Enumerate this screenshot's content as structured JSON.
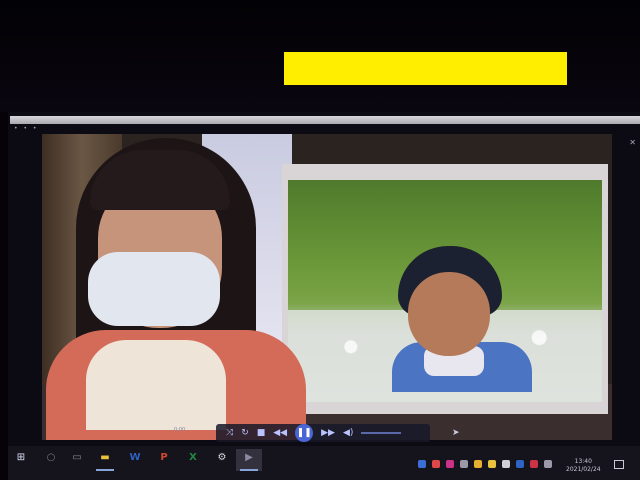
{
  "window": {
    "title_dots": "• • •",
    "close_glyph": "✕"
  },
  "player": {
    "time_elapsed": "0:00",
    "controls": {
      "shuffle_icon": "shuffle-icon",
      "repeat_icon": "repeat-icon",
      "stop_glyph": "■",
      "prev_glyph": "◀◀",
      "pause_glyph": "❚❚",
      "next_glyph": "▶▶",
      "volume_glyph": "🔈"
    },
    "censor_color": "#ffee00"
  },
  "taskbar": {
    "start_glyph": "⊞",
    "search_glyph": "○",
    "taskview_glyph": "▭",
    "apps": [
      {
        "name": "file-explorer",
        "glyph": "▬",
        "color": "#e8c23a"
      },
      {
        "name": "word",
        "glyph": "W",
        "color": "#2e63c4"
      },
      {
        "name": "powerpoint",
        "glyph": "P",
        "color": "#d04a2c"
      },
      {
        "name": "excel",
        "glyph": "X",
        "color": "#1f8a44"
      },
      {
        "name": "settings",
        "glyph": "⚙",
        "color": "#d8d8e0"
      },
      {
        "name": "media-player",
        "glyph": "▶",
        "color": "#8a8aa0"
      }
    ],
    "clock_time": "13:40",
    "clock_date": "2021/02/24",
    "tray_colors": [
      "#3b6fd8",
      "#e04848",
      "#cc3388",
      "#9a9aaa",
      "#e8b030",
      "#e8c23a",
      "#cfcfd8",
      "#2e63c4",
      "#cc3344",
      "#9a9aaa"
    ]
  }
}
